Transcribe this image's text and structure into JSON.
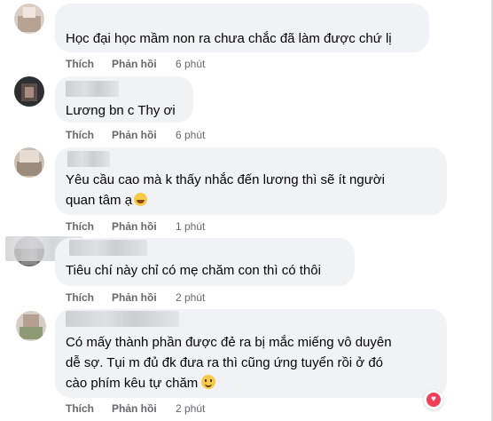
{
  "comments": [
    {
      "text_lines": [
        "Học đại học mầm non ra chưa chắc đã làm được chứ lị"
      ],
      "like": "Thích",
      "reply": "Phản hồi",
      "time": "6 phút"
    },
    {
      "text_lines": [
        "Lương bn c Thy ơi"
      ],
      "like": "Thích",
      "reply": "Phản hồi",
      "time": "6 phút"
    },
    {
      "text_lines": [
        "Yêu cầu cao mà k thấy nhắc đến lương thì sẽ ít người",
        "quan tâm ạ"
      ],
      "emoji": "rolling-laugh-emoji",
      "like": "Thích",
      "reply": "Phản hồi",
      "time": "1 phút"
    },
    {
      "text_lines": [
        "Tiêu chí này chỉ có mẹ chăm con thì có thôi"
      ],
      "like": "Thích",
      "reply": "Phản hồi",
      "time": "2 phút"
    },
    {
      "text_lines": [
        "Có mấy thành phần được đẻ ra bị mắc miếng vô duyên",
        "dễ sợ. Tụi m đủ đk đưa ra thì cũng ứng tuyển rồi ở đó",
        "cào phím kêu tự chăm"
      ],
      "emoji": "smile-emoji",
      "reaction": "heart-icon",
      "like": "Thích",
      "reply": "Phản hồi",
      "time": "2 phút"
    }
  ],
  "colors": {
    "bubble": "#f0f2f5",
    "text": "#050505",
    "meta": "#65676b",
    "heart": "#f33e58"
  }
}
